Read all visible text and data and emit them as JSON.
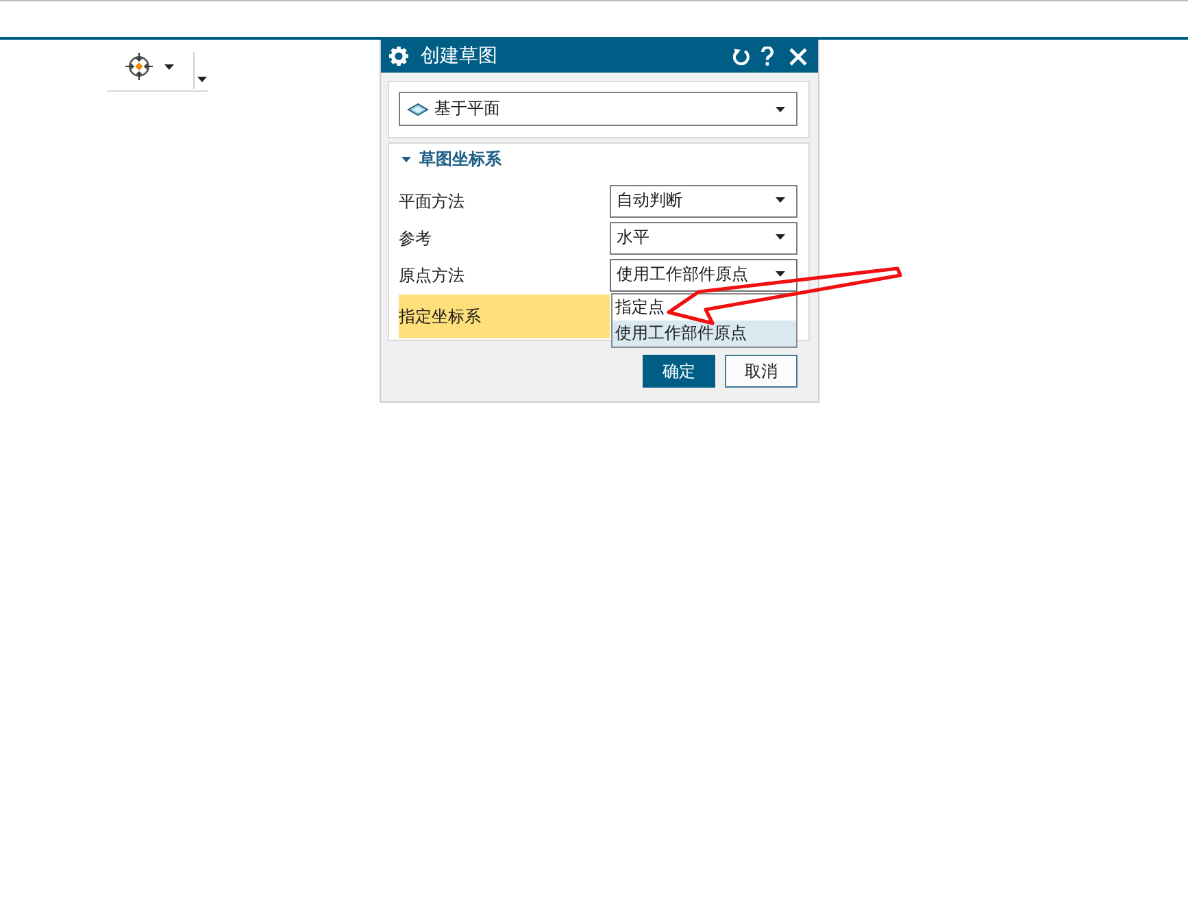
{
  "dialog": {
    "title": "创建草图",
    "type_select": {
      "value": "基于平面"
    },
    "section": {
      "title": "草图坐标系",
      "expanded": true,
      "rows": [
        {
          "kind": "dropdown",
          "label": "平面方法",
          "value": "自动判断",
          "open": false
        },
        {
          "kind": "dropdown",
          "label": "参考",
          "value": "水平",
          "open": false
        },
        {
          "kind": "dropdown",
          "label": "原点方法",
          "value": "使用工作部件原点",
          "open": true,
          "options": [
            {
              "label": "指定点",
              "selected": false
            },
            {
              "label": "使用工作部件原点",
              "selected": true
            }
          ]
        },
        {
          "kind": "selector",
          "label": "指定坐标系",
          "active": true
        }
      ]
    },
    "buttons": [
      {
        "label": "确定",
        "kind": "primary"
      },
      {
        "label": "取消",
        "kind": "secondary"
      }
    ]
  }
}
